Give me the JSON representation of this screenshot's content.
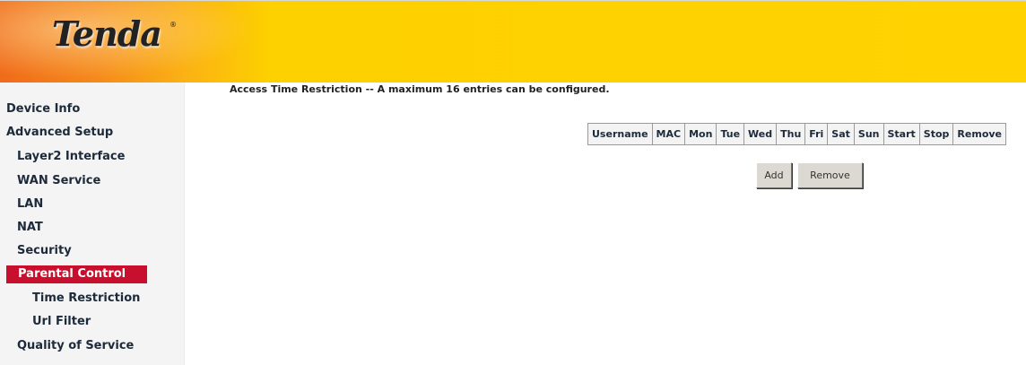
{
  "brand": {
    "logo_text": "Tenda",
    "registered_mark": "®"
  },
  "sidebar": {
    "items": [
      {
        "label": "Device Info",
        "level": 0
      },
      {
        "label": "Advanced Setup",
        "level": 0
      },
      {
        "label": "Layer2 Interface",
        "level": 1
      },
      {
        "label": "WAN Service",
        "level": 1
      },
      {
        "label": "LAN",
        "level": 1
      },
      {
        "label": "NAT",
        "level": 1
      },
      {
        "label": "Security",
        "level": 1
      },
      {
        "label": "Parental Control",
        "level": 1,
        "active": true
      },
      {
        "label": "Time Restriction",
        "level": 2
      },
      {
        "label": "Url Filter",
        "level": 2
      },
      {
        "label": "Quality of Service",
        "level": 1
      }
    ],
    "active_color": "#c8102e"
  },
  "main": {
    "heading": "Access Time Restriction -- A maximum 16 entries can be configured.",
    "table": {
      "columns": [
        "Username",
        "MAC",
        "Mon",
        "Tue",
        "Wed",
        "Thu",
        "Fri",
        "Sat",
        "Sun",
        "Start",
        "Stop",
        "Remove"
      ],
      "rows": []
    },
    "buttons": {
      "add": "Add",
      "remove": "Remove"
    }
  },
  "colors": {
    "header_orange": "#f06b1a",
    "header_yellow": "#ffd200"
  }
}
